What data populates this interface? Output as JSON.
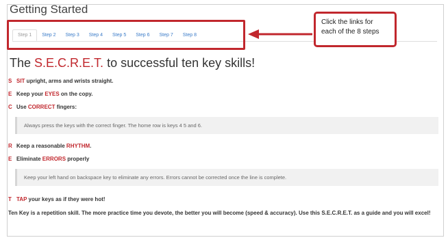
{
  "page": {
    "title": "Getting Started"
  },
  "tabs": [
    "Step 1",
    "Step 2",
    "Step 3",
    "Step 4",
    "Step 5",
    "Step 6",
    "Step 7",
    "Step 8"
  ],
  "callout": {
    "text": "Click the links for each of the 8 steps"
  },
  "headline": {
    "prefix": "The ",
    "accent": "S.E.C.R.E.T.",
    "suffix": " to successful ten key skills!"
  },
  "rows": [
    {
      "letter": "S",
      "kw": "SIT",
      "before": "",
      "after": " upright, arms and wrists straight."
    },
    {
      "letter": "E",
      "kw": "EYES",
      "before": "Keep your ",
      "after": " on the copy."
    },
    {
      "letter": "C",
      "kw": "CORRECT",
      "before": "Use ",
      "after": " fingers:"
    },
    {
      "letter": "R",
      "kw": "RHYTHM",
      "before": "Keep a reasonable ",
      "after": "."
    },
    {
      "letter": "E",
      "kw": "ERRORS",
      "before": "Eliminate ",
      "after": " properly"
    },
    {
      "letter": "T",
      "kw": "TAP",
      "before": "",
      "after": " your keys as if they were hot!"
    }
  ],
  "notes": [
    "Always press the keys with the correct finger. The home row is keys 4 5 and 6.",
    "Keep your left hand on backspace key to eliminate any errors. Errors cannot be corrected once the line is complete."
  ],
  "paragraph": "Ten Key is a repetition skill. The more practice time you devote, the better you will become (speed & accuracy). Use this S.E.C.R.E.T. as a guide and you will excel!",
  "colors": {
    "accent": "#c1272d",
    "link": "#3a7bc8"
  }
}
